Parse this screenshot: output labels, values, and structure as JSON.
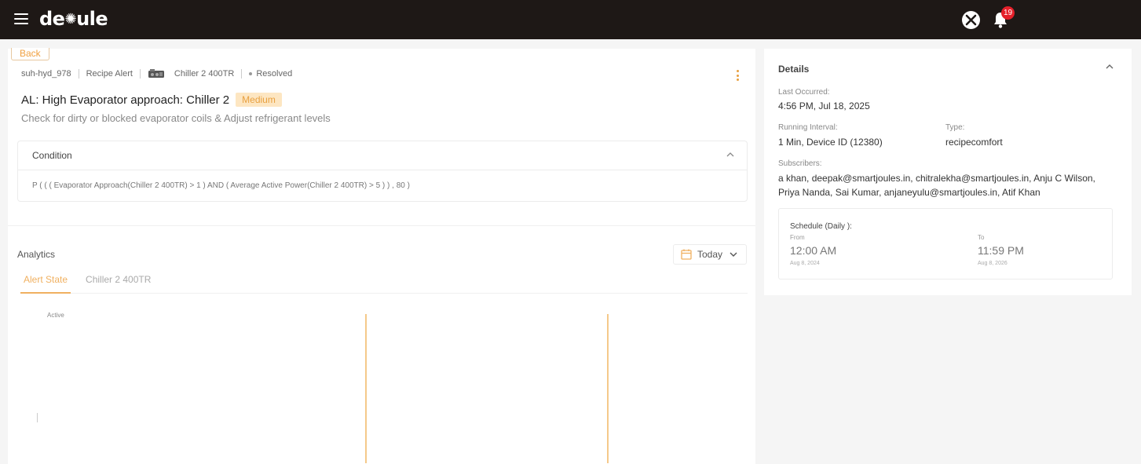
{
  "brand": {
    "logo_text_left": "de",
    "logo_text_right": "ule",
    "accent": "#f0a040"
  },
  "header": {
    "notification_count": "19"
  },
  "nav": {
    "back_label": "Back"
  },
  "alert": {
    "id": "suh-hyd_978",
    "category": "Recipe Alert",
    "asset": "Chiller 2 400TR",
    "status": "Resolved",
    "title": "AL: High Evaporator approach: Chiller 2",
    "severity": "Medium",
    "description": "Check for dirty or blocked evaporator coils & Adjust refrigerant levels"
  },
  "condition": {
    "title": "Condition",
    "expression": "P ( ( ( Evaporator Approach(Chiller 2 400TR) > 1 ) AND ( Average Active Power(Chiller 2 400TR) > 5 ) ) , 80 )"
  },
  "analytics": {
    "title": "Analytics",
    "date_range": "Today",
    "tabs": [
      {
        "label": "Alert State",
        "active": true
      },
      {
        "label": "Chiller 2 400TR",
        "active": false
      }
    ],
    "chart_y_label": "Active"
  },
  "details": {
    "title": "Details",
    "last_occurred_label": "Last Occurred:",
    "last_occurred_value": "4:56 PM, Jul 18, 2025",
    "running_interval_label": "Running Interval:",
    "running_interval_value": "1 Min, Device ID (12380)",
    "type_label": "Type:",
    "type_value": "recipecomfort",
    "subscribers_label": "Subscribers:",
    "subscribers_value": "a khan, deepak@smartjoules.in, chitralekha@smartjoules.in, Anju C Wilson, Priya Nanda, Sai Kumar, anjaneyulu@smartjoules.in, Atif Khan",
    "schedule": {
      "title": "Schedule (Daily ):",
      "from_label": "From",
      "from_time": "12:00 AM",
      "from_date": "Aug 8, 2024",
      "to_label": "To",
      "to_time": "11:59 PM",
      "to_date": "Aug 8, 2026"
    }
  }
}
